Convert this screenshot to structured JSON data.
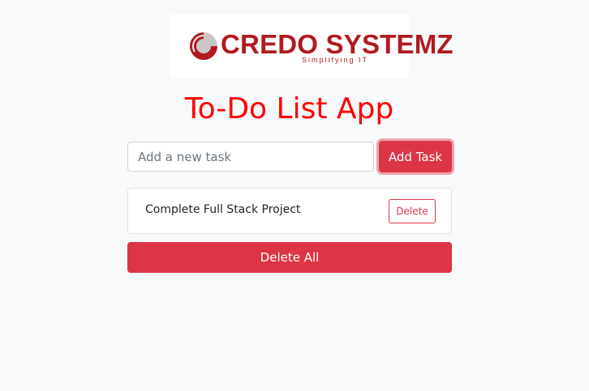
{
  "logo": {
    "name": "CREDO SYSTEMZ",
    "tagline": "Simplifying IT",
    "brand_color": "#b11a1f"
  },
  "title": "To-Do List App",
  "input": {
    "placeholder": "Add a new task",
    "value": ""
  },
  "add_button": {
    "label": "Add Task"
  },
  "tasks": [
    {
      "text": "Complete Full Stack Project",
      "delete_label": "Delete"
    }
  ],
  "delete_all_button": {
    "label": "Delete All"
  },
  "colors": {
    "accent": "#dc3545",
    "title": "#ff0000",
    "background": "#f8f9fa"
  }
}
